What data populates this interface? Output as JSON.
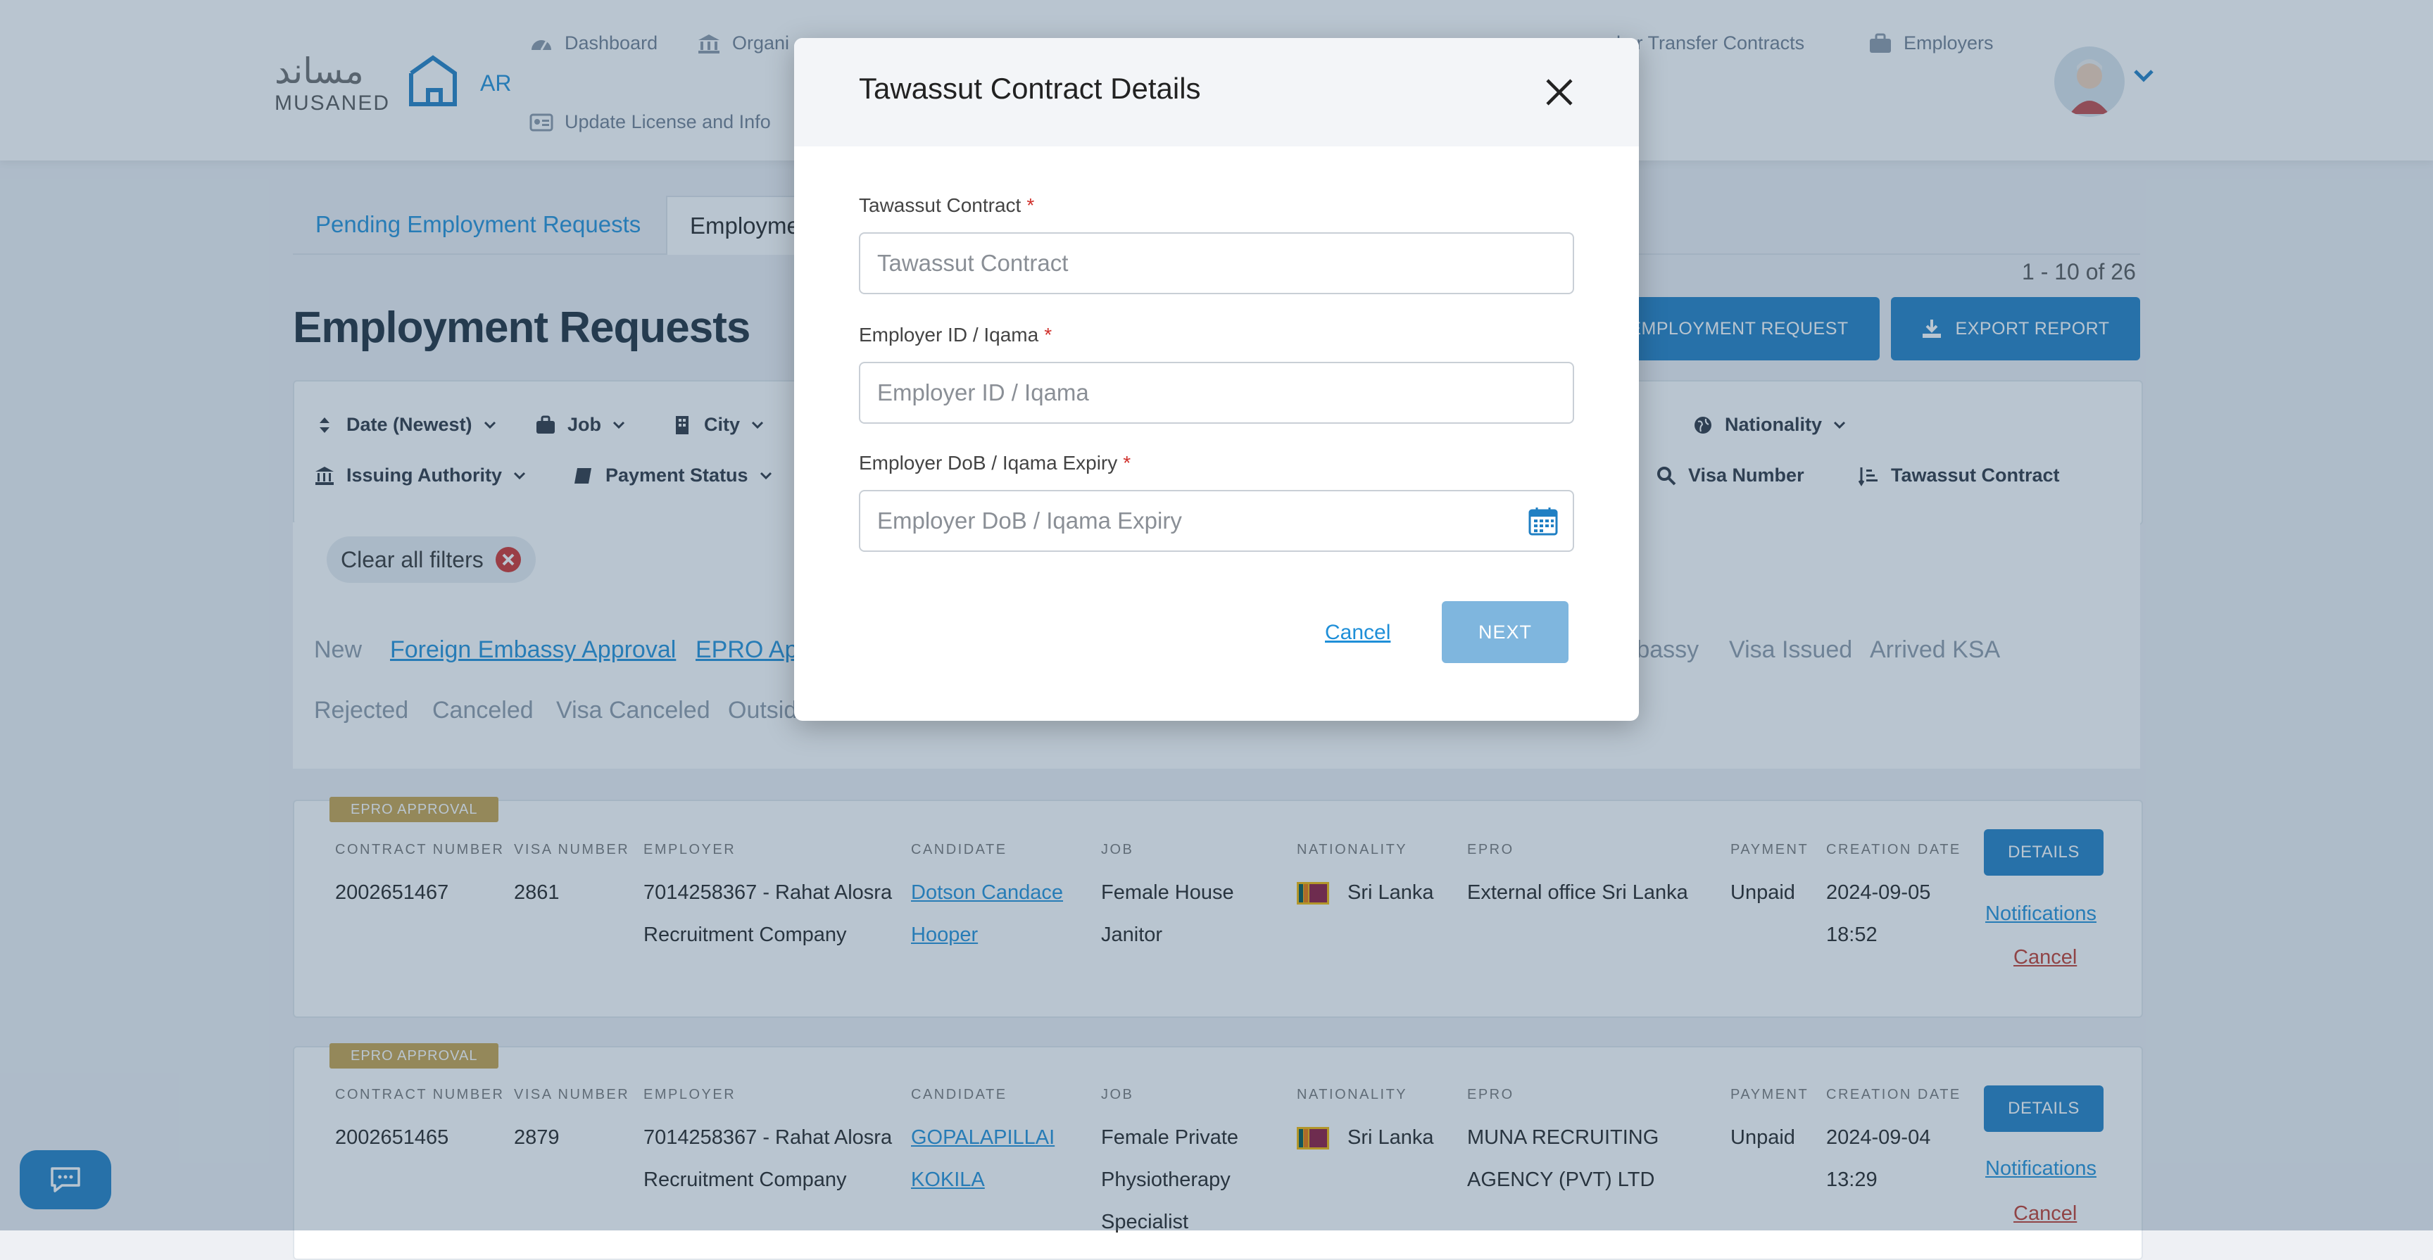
{
  "header": {
    "logo_ar": "مساند",
    "logo_en": "MUSANED",
    "lang": "AR",
    "nav": [
      {
        "label": "Dashboard",
        "icon": "dashboard-icon"
      },
      {
        "label": "Organi",
        "icon": "bank-icon"
      },
      {
        "label": "ker Transfer Contracts",
        "icon": "document-icon"
      },
      {
        "label": "Employers",
        "icon": "briefcase-icon"
      },
      {
        "label": "Update License and Info",
        "icon": "id-card-icon"
      }
    ]
  },
  "tabs": {
    "pending": "Pending Employment Requests",
    "employment": "Employme"
  },
  "page": {
    "title": "Employment Requests",
    "range": "1 - 10 of 26",
    "new_request": "EMPLOYMENT REQUEST",
    "export": "EXPORT REPORT"
  },
  "filters": {
    "date": "Date (Newest)",
    "job": "Job",
    "city": "City",
    "nationality": "Nationality",
    "issuing_authority": "Issuing Authority",
    "payment_status": "Payment Status",
    "visa_number": "Visa Number",
    "tawassut_contract": "Tawassut Contract"
  },
  "clear_filters": "Clear all filters",
  "statuses": {
    "row1": [
      "New",
      "Foreign Embassy Approval",
      "EPRO Appr",
      "mbassy",
      "Visa Issued",
      "Arrived KSA"
    ],
    "row2": [
      "Rejected",
      "Canceled",
      "Visa Canceled",
      "Outsid"
    ]
  },
  "table": {
    "headers": [
      "CONTRACT NUMBER",
      "VISA NUMBER",
      "EMPLOYER",
      "CANDIDATE",
      "JOB",
      "NATIONALITY",
      "EPRO",
      "PAYMENT",
      "CREATION DATE"
    ],
    "details_label": "DETAILS",
    "notifications_label": "Notifications",
    "cancel_label": "Cancel",
    "rows": [
      {
        "badge": "EPRO APPROVAL",
        "contract": "2002651467",
        "visa": "2861",
        "employer_1": "7014258367 - Rahat Alosra",
        "employer_2": "Recruitment Company",
        "candidate_1": "Dotson Candace",
        "candidate_2": "Hooper",
        "job_1": "Female House",
        "job_2": "Janitor",
        "job_3": "",
        "nationality": "Sri Lanka",
        "epro_1": "External office Sri Lanka",
        "epro_2": "",
        "payment": "Unpaid",
        "date": "2024-09-05",
        "time": "18:52"
      },
      {
        "badge": "EPRO APPROVAL",
        "contract": "2002651465",
        "visa": "2879",
        "employer_1": "7014258367 - Rahat Alosra",
        "employer_2": "Recruitment Company",
        "candidate_1": "GOPALAPILLAI",
        "candidate_2": "KOKILA",
        "job_1": "Female Private",
        "job_2": "Physiotherapy",
        "job_3": "Specialist",
        "nationality": "Sri Lanka",
        "epro_1": "MUNA RECRUITING",
        "epro_2": "AGENCY (PVT) LTD",
        "payment": "Unpaid",
        "date": "2024-09-04",
        "time": "13:29"
      }
    ]
  },
  "modal": {
    "title": "Tawassut Contract Details",
    "fields": [
      {
        "label": "Tawassut Contract",
        "placeholder": "Tawassut Contract",
        "value": ""
      },
      {
        "label": "Employer ID / Iqama",
        "placeholder": "Employer ID / Iqama",
        "value": ""
      },
      {
        "label": "Employer DoB / Iqama Expiry",
        "placeholder": "Employer DoB / Iqama Expiry",
        "value": ""
      }
    ],
    "required_mark": "*",
    "cancel": "Cancel",
    "next": "NEXT"
  },
  "colors": {
    "primary": "#1f7fc3",
    "link": "#1f8fd8",
    "badge": "#c7a24a",
    "danger": "#d0302b",
    "next_disabled": "#7fb6de"
  }
}
